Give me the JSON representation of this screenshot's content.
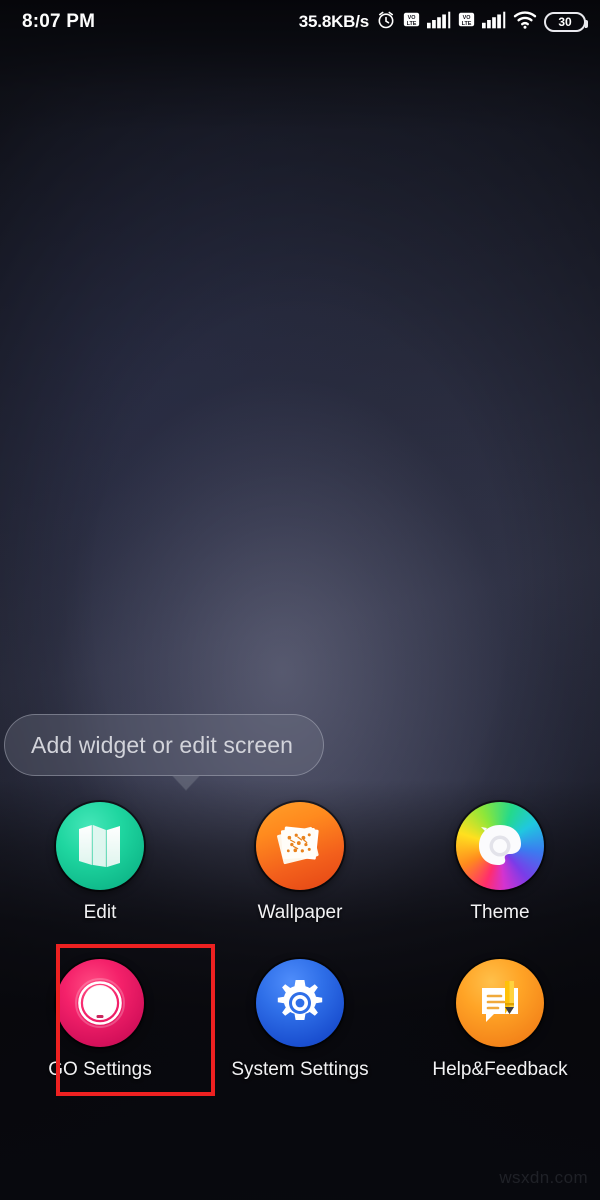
{
  "statusbar": {
    "time": "8:07 PM",
    "network_speed": "35.8KB/s",
    "alarm_icon": "alarm-clock-icon",
    "sim1_volte_icon": "volte-icon",
    "sim1_signal_icon": "signal-bars-icon",
    "sim2_volte_icon": "volte-icon",
    "sim2_signal_icon": "signal-bars-icon",
    "wifi_icon": "wifi-icon",
    "battery_level": "30"
  },
  "tooltip": {
    "text": "Add widget or edit screen"
  },
  "menu": {
    "rows": [
      [
        {
          "label": "Edit",
          "icon": "edit-pages-icon",
          "style": "bg-edit"
        },
        {
          "label": "Wallpaper",
          "icon": "wallpaper-photos-icon",
          "style": "bg-wallpaper"
        },
        {
          "label": "Theme",
          "icon": "theme-colorwheel-icon",
          "style": "bg-theme"
        }
      ],
      [
        {
          "label": "GO Settings",
          "icon": "go-settings-dial-icon",
          "style": "bg-gosettings"
        },
        {
          "label": "System Settings",
          "icon": "gear-icon",
          "style": "bg-syssettings"
        },
        {
          "label": "Help&Feedback",
          "icon": "feedback-pencil-icon",
          "style": "bg-help"
        }
      ]
    ]
  },
  "highlight": {
    "target_label": "GO Settings",
    "color": "#ee2121"
  },
  "watermark": {
    "text": "wsxdn.com"
  },
  "colors": {
    "accent_red": "#ee2121",
    "edit_green": "#1fd6a0",
    "wallpaper_orange": "#f3601c",
    "go_settings_pink": "#f4216a",
    "system_settings_blue": "#2f6fe8",
    "help_amber": "#ffa426"
  }
}
